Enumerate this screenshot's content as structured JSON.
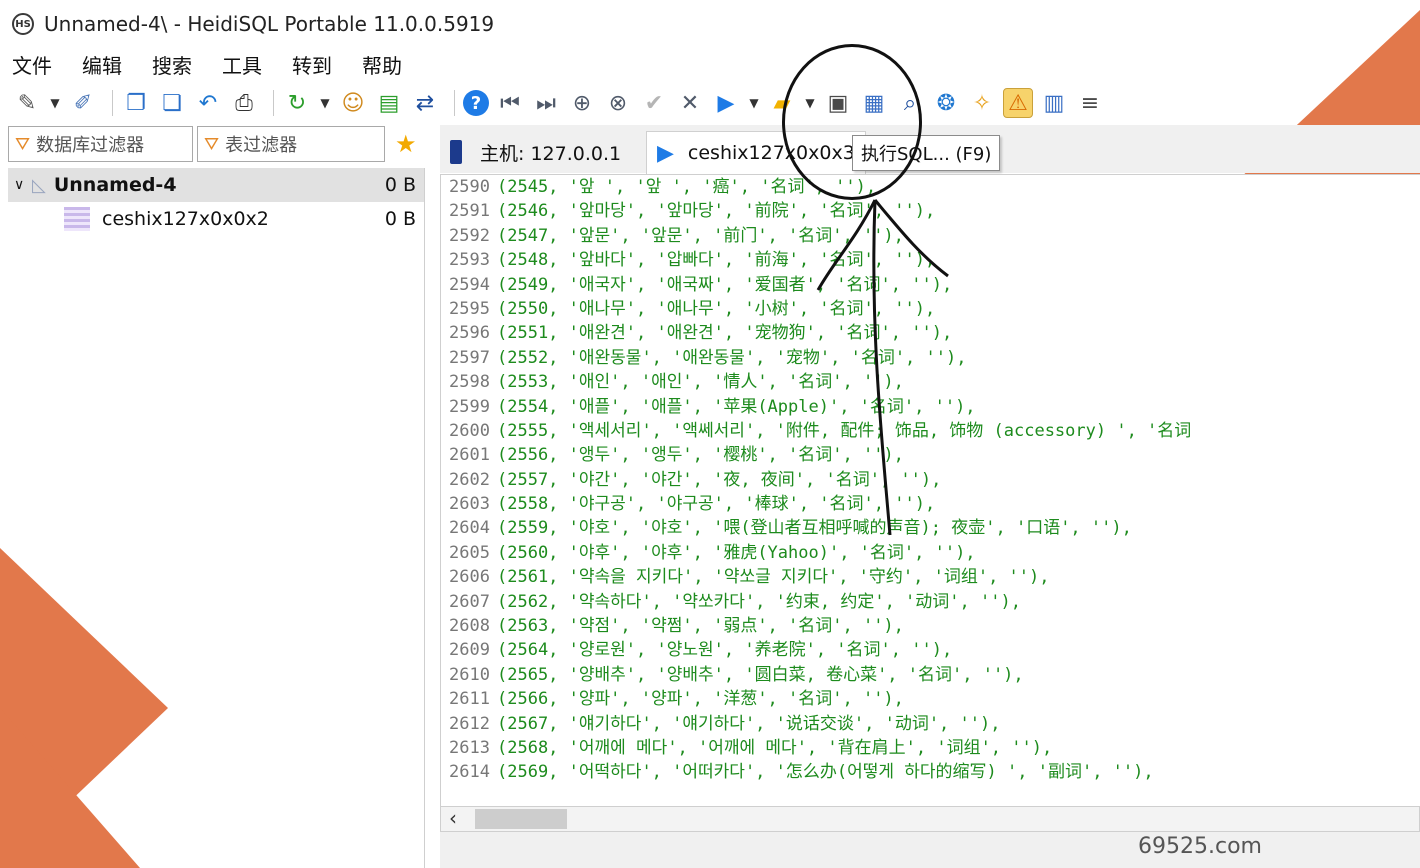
{
  "window": {
    "app_icon_text": "HS",
    "title": "Unnamed-4\\ - HeidiSQL Portable 11.0.0.5919"
  },
  "menu": {
    "items": [
      "文件",
      "编辑",
      "搜索",
      "工具",
      "转到",
      "帮助"
    ]
  },
  "toolbar": {
    "items": [
      {
        "icon": "connect-icon",
        "glyph": "✎",
        "color": "#5a5a5a"
      },
      {
        "icon": "disconnect-icon",
        "glyph": "✐",
        "color": "#4d78b8"
      },
      {
        "icon": "copy-icon",
        "glyph": "❐",
        "color": "#2a6fc9"
      },
      {
        "icon": "paste-icon",
        "glyph": "❏",
        "color": "#2a6fc9"
      },
      {
        "icon": "undo-icon",
        "glyph": "↶",
        "color": "#1f77d0"
      },
      {
        "icon": "print-icon",
        "glyph": "⎙",
        "color": "#333333"
      },
      {
        "icon": "refresh-icon",
        "glyph": "↻",
        "color": "#2c9e2c"
      },
      {
        "icon": "user-manager-icon",
        "glyph": "☺",
        "color": "#d08a1f"
      },
      {
        "icon": "export-icon",
        "glyph": "▤",
        "color": "#2c9e2c"
      },
      {
        "icon": "sync-icon",
        "glyph": "⇄",
        "color": "#1f4f9e"
      },
      {
        "icon": "help-icon",
        "glyph": "?",
        "color": "#ffffff"
      },
      {
        "icon": "first-icon",
        "glyph": "⏮",
        "color": "#505a6a"
      },
      {
        "icon": "last-icon",
        "glyph": "⏭",
        "color": "#505a6a"
      },
      {
        "icon": "add-icon",
        "glyph": "⊕",
        "color": "#505a6a"
      },
      {
        "icon": "delete-icon",
        "glyph": "⊗",
        "color": "#505a6a"
      },
      {
        "icon": "apply-icon",
        "glyph": "✔",
        "color": "#b5b5b5"
      },
      {
        "icon": "cancel-icon",
        "glyph": "✕",
        "color": "#505a6a"
      },
      {
        "icon": "run-sql-icon",
        "glyph": "▶",
        "color": "#1e7be6"
      },
      {
        "icon": "folder-icon",
        "glyph": "▰",
        "color": "#f2b200"
      },
      {
        "icon": "save-icon",
        "glyph": "▣",
        "color": "#4a4a4a"
      },
      {
        "icon": "save-as-icon",
        "glyph": "▦",
        "color": "#3a6fc4"
      },
      {
        "icon": "search-icon",
        "glyph": "⌕",
        "color": "#1f4f9e"
      },
      {
        "icon": "replace-icon",
        "glyph": "❂",
        "color": "#1f77d0"
      },
      {
        "icon": "clear-icon",
        "glyph": "✧",
        "color": "#e8a11b"
      },
      {
        "icon": "warning-icon",
        "glyph": "⚠",
        "color": "#d86a00"
      },
      {
        "icon": "binary-icon",
        "glyph": "▥",
        "color": "#3a6fc4"
      },
      {
        "icon": "wrap-icon",
        "glyph": "≡",
        "color": "#4a4a4a"
      }
    ]
  },
  "filters": {
    "db_label": "数据库过滤器",
    "table_label": "表过滤器"
  },
  "tree": {
    "items": [
      {
        "label": "Unnamed-4",
        "size": "0 B"
      },
      {
        "label": "ceshix127x0x0x2",
        "size": "0 B"
      }
    ]
  },
  "tabs": {
    "host": "主机: 127.0.0.1",
    "query": "ceshix127x0x0x3"
  },
  "tooltip": "执行SQL... (F9)",
  "editor": {
    "lines": [
      {
        "ln": "2590",
        "text": "(2545, '앞 ', '앞 ', '癌', '名词', ''),"
      },
      {
        "ln": "2591",
        "text": "(2546, '앞마당', '앞마당', '前院', '名词', ''),"
      },
      {
        "ln": "2592",
        "text": "(2547, '앞문', '앞문', '前门', '名词', ''),"
      },
      {
        "ln": "2593",
        "text": "(2548, '앞바다', '압빠다', '前海', '名词', ''),"
      },
      {
        "ln": "2594",
        "text": "(2549, '애국자', '애국짜', '爱国者', '名词', ''),"
      },
      {
        "ln": "2595",
        "text": "(2550, '애나무', '애나무', '小树', '名词', ''),"
      },
      {
        "ln": "2596",
        "text": "(2551, '애완견', '애완견', '宠物狗', '名词', ''),"
      },
      {
        "ln": "2597",
        "text": "(2552, '애완동물', '애완동물', '宠物', '名词', ''),"
      },
      {
        "ln": "2598",
        "text": "(2553, '애인', '애인', '情人', '名词', ''),"
      },
      {
        "ln": "2599",
        "text": "(2554, '애플', '애플', '苹果(Apple)', '名词', ''),"
      },
      {
        "ln": "2600",
        "text": "(2555, '액세서리', '액쎄서리', '附件, 配件; 饰品, 饰物 (accessory) ', '名词"
      },
      {
        "ln": "2601",
        "text": "(2556, '앵두', '앵두', '樱桃', '名词', ''),"
      },
      {
        "ln": "2602",
        "text": "(2557, '야간', '야간', '夜, 夜间', '名词', ''),"
      },
      {
        "ln": "2603",
        "text": "(2558, '야구공', '야구공', '棒球', '名词', ''),"
      },
      {
        "ln": "2604",
        "text": "(2559, '야호', '야호', '喂(登山者互相呼喊的声音); 夜壶', '口语', ''),"
      },
      {
        "ln": "2605",
        "text": "(2560, '야후', '야후', '雅虎(Yahoo)', '名词', ''),"
      },
      {
        "ln": "2606",
        "text": "(2561, '약속을 지키다', '약쏘글 지키다', '守约', '词组', ''),"
      },
      {
        "ln": "2607",
        "text": "(2562, '약속하다', '약쏘카다', '约束, 约定', '动词', ''),"
      },
      {
        "ln": "2608",
        "text": "(2563, '약점', '약쩜', '弱点', '名词', ''),"
      },
      {
        "ln": "2609",
        "text": "(2564, '양로원', '양노원', '养老院', '名词', ''),"
      },
      {
        "ln": "2610",
        "text": "(2565, '양배추', '양배추', '圆白菜, 卷心菜', '名词', ''),"
      },
      {
        "ln": "2611",
        "text": "(2566, '양파', '양파', '洋葱', '名词', ''),"
      },
      {
        "ln": "2612",
        "text": "(2567, '얘기하다', '얘기하다', '说话交谈', '动词', ''),"
      },
      {
        "ln": "2613",
        "text": "(2568, '어깨에 메다', '어깨에 메다', '背在肩上', '词组', ''),"
      },
      {
        "ln": "2614",
        "text": "(2569, '어떡하다', '어떠카다', '怎么办(어떻게 하다的缩写) ', '副词', ''),"
      }
    ]
  },
  "watermark": "69525.com",
  "colors": {
    "accent_orange": "#e2784b",
    "line_number": "#777777",
    "string": "#1d8b1d",
    "number": "#4a3aa8"
  }
}
